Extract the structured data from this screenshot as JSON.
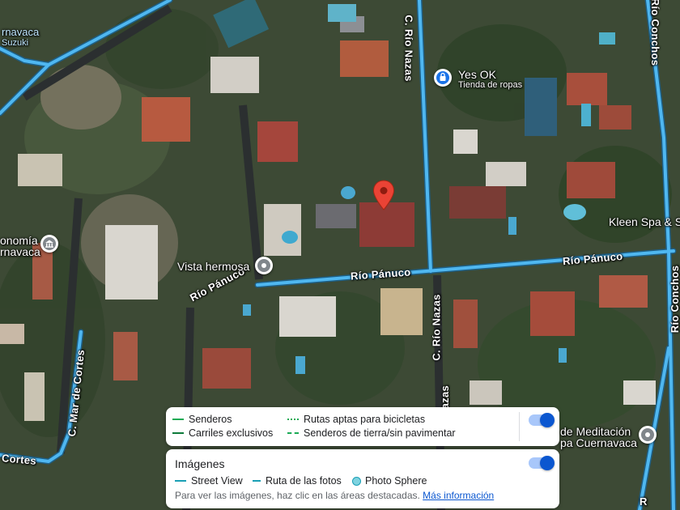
{
  "map": {
    "roads": {
      "rio_panuco_main": "Río Pánuco",
      "rio_panuco_bend": "Río Pánuco",
      "rio_panuco_east": "Río Pánuco",
      "c_rio_nazas_top": "C. Río Nazas",
      "c_rio_nazas_bottom": "C. Río Nazas",
      "rio_conchos_top": "Río Conchos",
      "rio_conchos_bottom": "Río Conchos",
      "c_mar_de_cortes": "C. Mar de Cortes",
      "cortes_partial": "Cortes",
      "nazas_partial": "Nazas"
    },
    "places": {
      "yes_ok_name": "Yes OK",
      "yes_ok_category": "Tienda de ropas",
      "vista_hermosa": "Vista hermosa",
      "kleen_spa": "Kleen Spa & Sa",
      "economia_line1": "onomía",
      "economia_line2": "rnavaca",
      "meditacion_line1": "de Meditación",
      "meditacion_line2": "pa Cuernavaca",
      "cuernavaca_partial": "rnavaca",
      "suzuki_partial": "Suzuki",
      "bottom_right_partial": "R"
    },
    "icons": {
      "shopping": "shopping-bag-icon",
      "museum": "museum-icon",
      "place": "place-icon",
      "pin": "location-pin-icon"
    },
    "colors": {
      "street_view_line": "#4fb7f0",
      "pin": "#ea4335",
      "trail": "#1aaa55",
      "toggle": "#0b57d0"
    }
  },
  "bike_legend": {
    "senderos": "Senderos",
    "carriles_exclusivos": "Carriles exclusivos",
    "rutas_aptas": "Rutas aptas para bicicletas",
    "senderos_tierra": "Senderos de tierra/sin pavimentar",
    "toggle_on": true
  },
  "imagery_panel": {
    "title": "Imágenes",
    "street_view": "Street View",
    "ruta_fotos": "Ruta de las fotos",
    "photo_sphere": "Photo Sphere",
    "note": "Para ver las imágenes, haz clic en las áreas destacadas.",
    "more_info": "Más información",
    "toggle_on": true
  }
}
